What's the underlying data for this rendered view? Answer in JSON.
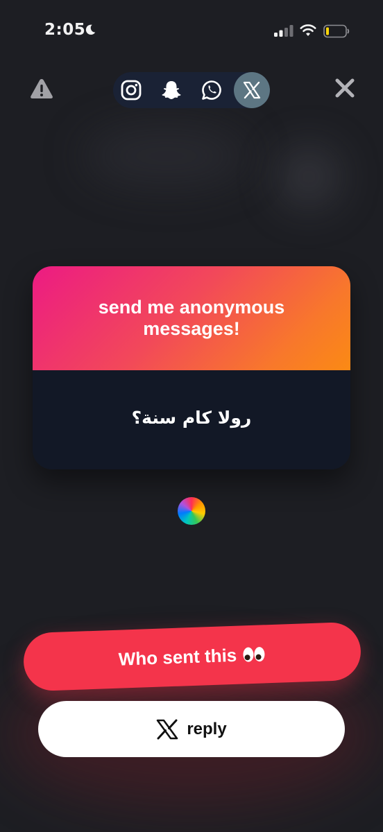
{
  "status_bar": {
    "time": "2:05",
    "icons": [
      "moon-icon",
      "signal-icon",
      "wifi-icon",
      "battery-icon"
    ],
    "battery_color": "#ffd60a"
  },
  "toolbar": {
    "left_icon": "warning-icon",
    "share_targets": [
      "instagram-icon",
      "snapchat-icon",
      "whatsapp-icon",
      "x-icon"
    ],
    "selected_share_target": "x-icon",
    "right_icon": "close-icon"
  },
  "card": {
    "title": "send me anonymous messages!",
    "message": "رولا كام سنة؟",
    "gradient_colors": [
      "#ec1b83",
      "#f2485a",
      "#fb8a14"
    ]
  },
  "actions": {
    "who_sent_label": "Who sent this",
    "who_sent_emoji_icon": "eyes-icon",
    "reply_label": "reply",
    "reply_icon": "x-icon"
  },
  "colors": {
    "background": "#1d1e23",
    "primary_button": "#f4344b",
    "card_body": "#121826",
    "share_pill": "#1a2235",
    "selected_share": "#5d7683"
  }
}
